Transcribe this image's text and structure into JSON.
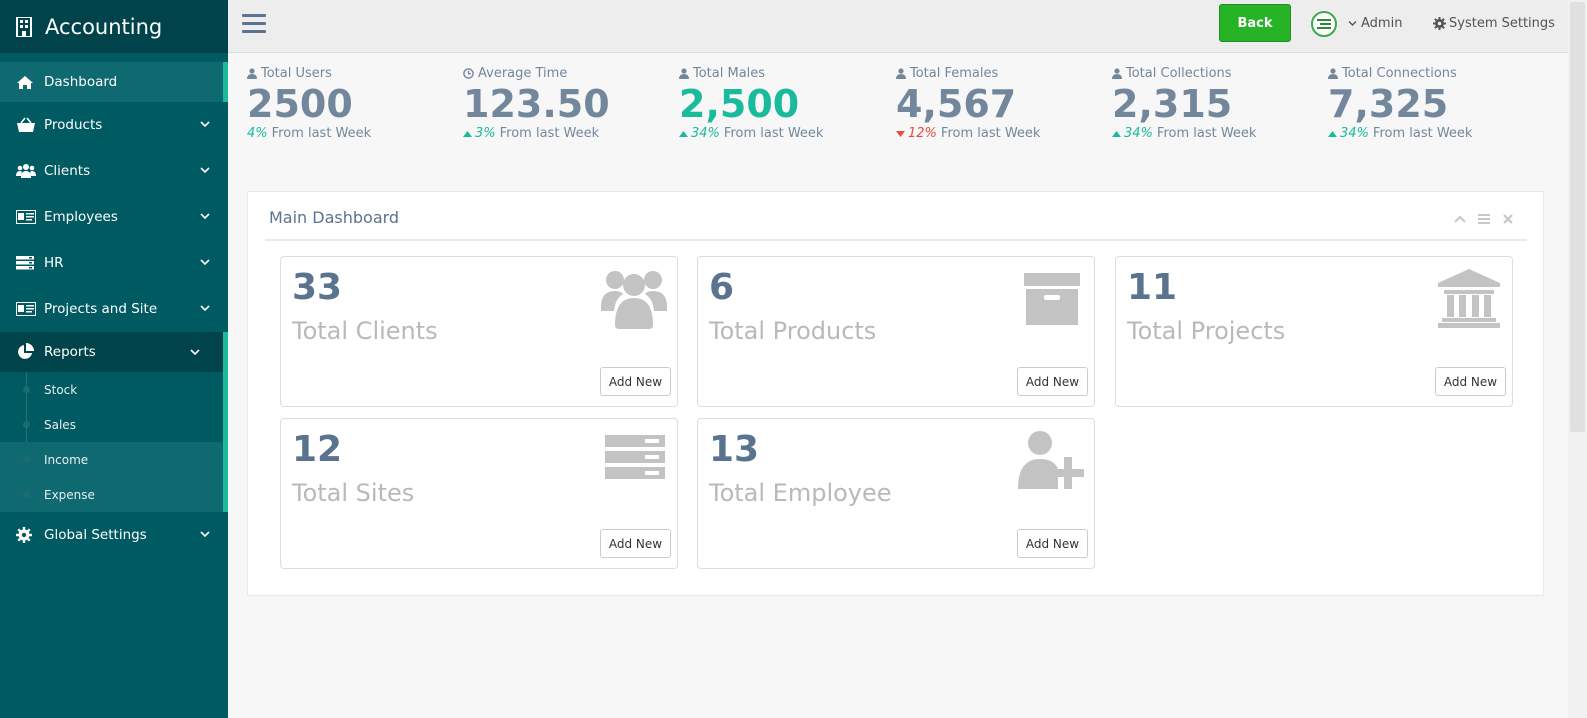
{
  "sidebar": {
    "brand": "Accounting",
    "items": [
      {
        "label": "Dashboard",
        "icon": "home-icon"
      },
      {
        "label": "Products",
        "icon": "basket-icon"
      },
      {
        "label": "Clients",
        "icon": "users-icon"
      },
      {
        "label": "Employees",
        "icon": "id-card-icon"
      },
      {
        "label": "HR",
        "icon": "server-icon"
      },
      {
        "label": "Projects and Site",
        "icon": "id-card-icon"
      },
      {
        "label": "Reports",
        "icon": "pie-chart-icon"
      },
      {
        "label": "Global Settings",
        "icon": "gear-icon"
      }
    ],
    "reports_sub": [
      "Stock",
      "Sales",
      "Income",
      "Expense"
    ]
  },
  "topnav": {
    "back_label": "Back",
    "user_label": "Admin",
    "settings_label": "System Settings"
  },
  "stats": [
    {
      "label": "Total Users",
      "value": "2500",
      "change": "4%",
      "suffix": "From last Week",
      "trend": "none"
    },
    {
      "label": "Average Time",
      "value": "123.50",
      "change": "3%",
      "suffix": "From last Week",
      "trend": "up"
    },
    {
      "label": "Total Males",
      "value": "2,500",
      "change": "34%",
      "suffix": "From last Week",
      "trend": "up"
    },
    {
      "label": "Total Females",
      "value": "4,567",
      "change": "12%",
      "suffix": "From last Week",
      "trend": "down"
    },
    {
      "label": "Total Collections",
      "value": "2,315",
      "change": "34%",
      "suffix": "From last Week",
      "trend": "up"
    },
    {
      "label": "Total Connections",
      "value": "7,325",
      "change": "34%",
      "suffix": "From last Week",
      "trend": "up"
    }
  ],
  "panel": {
    "title": "Main Dashboard",
    "tiles": [
      {
        "count": "33",
        "name": "Total Clients",
        "icon": "users-icon",
        "button": "Add New"
      },
      {
        "count": "6",
        "name": "Total Products",
        "icon": "archive-icon",
        "button": "Add New"
      },
      {
        "count": "11",
        "name": "Total Projects",
        "icon": "bank-icon",
        "button": "Add New"
      },
      {
        "count": "12",
        "name": "Total Sites",
        "icon": "server-icon",
        "button": "Add New"
      },
      {
        "count": "13",
        "name": "Total Employee",
        "icon": "user-plus-icon",
        "button": "Add New"
      }
    ]
  },
  "colors": {
    "sidebar": "#005a62",
    "accent": "#1abb9c",
    "back_button": "#26b326",
    "down": "#e74c3c"
  }
}
